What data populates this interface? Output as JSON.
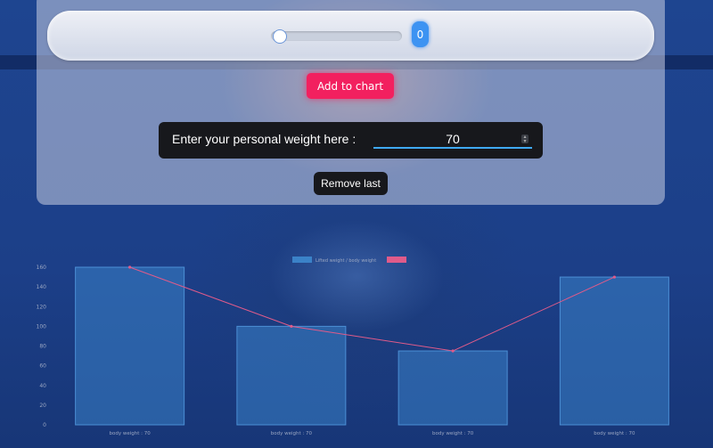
{
  "controls": {
    "slider_value": "0",
    "add_button_label": "Add to chart",
    "weight_label": "Enter your personal weight here :",
    "weight_value": "70",
    "remove_button_label": "Remove last"
  },
  "chart_data": {
    "type": "bar",
    "legend": [
      "Lifted weight / body weight",
      ""
    ],
    "series": [
      {
        "values": [
          160,
          100,
          75,
          150
        ],
        "color": "#3b82c8"
      },
      {
        "values": [
          160,
          100,
          75,
          150
        ],
        "color": "#e05b8a"
      }
    ],
    "categories": [
      "body weight : 70",
      "body weight : 70",
      "body weight : 70",
      "body weight : 70"
    ],
    "yticks": [
      0,
      20,
      40,
      60,
      80,
      100,
      120,
      140,
      160
    ],
    "ylim": [
      0,
      160
    ]
  }
}
